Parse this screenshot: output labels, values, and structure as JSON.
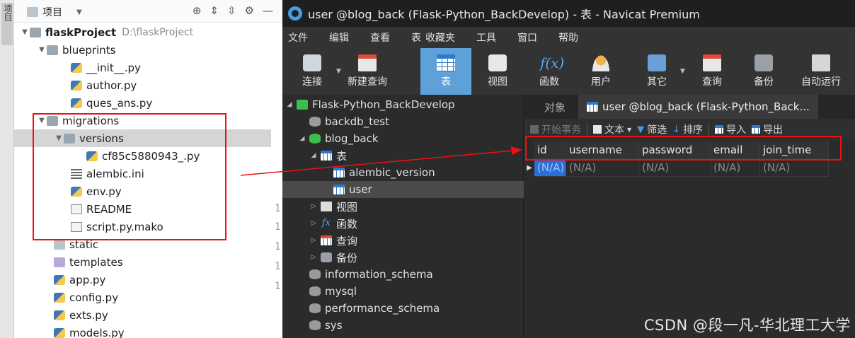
{
  "ide": {
    "strip_label": "项目",
    "header_title": "项目",
    "tree": [
      {
        "label": "flaskProject",
        "path": "D:\\flaskProject",
        "type": "folder",
        "expanded": true
      },
      {
        "label": "blueprints",
        "type": "folder",
        "expanded": true
      },
      {
        "label": "__init__.py",
        "type": "py"
      },
      {
        "label": "author.py",
        "type": "py"
      },
      {
        "label": "ques_ans.py",
        "type": "py"
      },
      {
        "label": "migrations",
        "type": "folder",
        "expanded": true
      },
      {
        "label": "versions",
        "type": "folder",
        "expanded": true,
        "selected": true
      },
      {
        "label": "cf85c5880943_.py",
        "type": "py"
      },
      {
        "label": "alembic.ini",
        "type": "ini"
      },
      {
        "label": "env.py",
        "type": "py"
      },
      {
        "label": "README",
        "type": "txt"
      },
      {
        "label": "script.py.mako",
        "type": "txt"
      },
      {
        "label": "static",
        "type": "folder"
      },
      {
        "label": "templates",
        "type": "folder"
      },
      {
        "label": "app.py",
        "type": "py"
      },
      {
        "label": "config.py",
        "type": "py"
      },
      {
        "label": "exts.py",
        "type": "py"
      },
      {
        "label": "models.py",
        "type": "py"
      }
    ],
    "gutter_numbers": [
      "1",
      "1",
      "1",
      "1",
      "1"
    ]
  },
  "navicat": {
    "title": "user @blog_back (Flask-Python_BackDevelop) - 表 - Navicat Premium",
    "menu": [
      "文件",
      "编辑",
      "查看",
      "表",
      "收藏夹",
      "工具",
      "窗口",
      "帮助"
    ],
    "toolbar": [
      {
        "label": "连接",
        "icon": "plug-icon"
      },
      {
        "label": "新建查询",
        "icon": "new-query-icon"
      },
      {
        "label": "表",
        "icon": "table-icon",
        "active": true
      },
      {
        "label": "视图",
        "icon": "view-icon"
      },
      {
        "label": "函数",
        "icon": "function-icon"
      },
      {
        "label": "用户",
        "icon": "user-icon"
      },
      {
        "label": "其它",
        "icon": "other-icon"
      },
      {
        "label": "查询",
        "icon": "query-icon"
      },
      {
        "label": "备份",
        "icon": "backup-icon"
      },
      {
        "label": "自动运行",
        "icon": "automation-icon"
      }
    ],
    "tree": [
      {
        "label": "Flask-Python_BackDevelop",
        "icon": "connection-icon",
        "expanded": true
      },
      {
        "label": "backdb_test",
        "icon": "database-icon"
      },
      {
        "label": "blog_back",
        "icon": "database-icon",
        "expanded": true,
        "active_db": true
      },
      {
        "label": "表",
        "icon": "table-group-icon",
        "expanded": true
      },
      {
        "label": "alembic_version",
        "icon": "table-icon"
      },
      {
        "label": "user",
        "icon": "table-icon",
        "selected": true
      },
      {
        "label": "视图",
        "icon": "view-group-icon"
      },
      {
        "label": "函数",
        "icon": "function-group-icon"
      },
      {
        "label": "查询",
        "icon": "query-group-icon"
      },
      {
        "label": "备份",
        "icon": "backup-group-icon"
      },
      {
        "label": "information_schema",
        "icon": "database-icon"
      },
      {
        "label": "mysql",
        "icon": "database-icon"
      },
      {
        "label": "performance_schema",
        "icon": "database-icon"
      },
      {
        "label": "sys",
        "icon": "database-icon"
      }
    ],
    "tabs": [
      {
        "label": "对象"
      },
      {
        "label": "user @blog_back (Flask-Python_Back..."
      }
    ],
    "object_toolbar": {
      "begin_transaction": "开始事务",
      "text": "文本",
      "filter": "筛选",
      "sort": "排序",
      "import": "导入",
      "export": "导出"
    },
    "grid": {
      "columns": [
        "id",
        "username",
        "password",
        "email",
        "join_time"
      ],
      "rows": [
        [
          "(N/A)",
          "(N/A)",
          "(N/A)",
          "(N/A)",
          "(N/A)"
        ]
      ]
    }
  },
  "watermark": "CSDN @段一凡-华北理工大学",
  "colors": {
    "highlight_red": "#e11111",
    "navicat_accent": "#5ea1d8",
    "db_green": "#3cbf4a"
  }
}
